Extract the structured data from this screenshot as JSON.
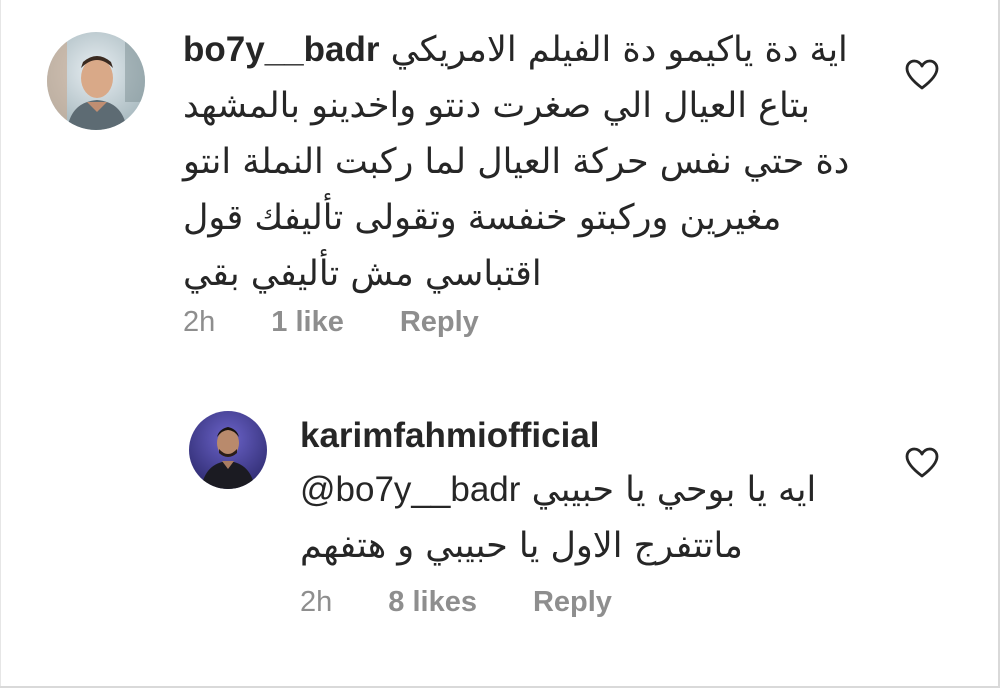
{
  "comments": [
    {
      "username": "bo7y__badr",
      "lines": [
        "اية دة ياكيمو دة الفيلم الامريكي",
        "بتاع العيال الي صغرت دنتو واخدينو بالمشهد",
        "دة حتي نفس حركة العيال لما ركبت النملة انتو",
        "مغيرين وركبتو خنفسة وتقولى تأليفك قول",
        "اقتباسي مش تأليفي بقي"
      ],
      "time": "2h",
      "likes": "1 like",
      "reply_label": "Reply",
      "avatar_icon": "profile-photo"
    },
    {
      "username": "karimfahmiofficial",
      "mention": "@bo7y__badr",
      "lines": [
        "ايه يا بوحي يا حبيبي",
        "ماتتفرج الاول يا حبيبي و هتفهم"
      ],
      "time": "2h",
      "likes": "8 likes",
      "reply_label": "Reply",
      "avatar_icon": "profile-photo"
    }
  ],
  "icons": {
    "like": "heart-outline-icon"
  },
  "colors": {
    "text": "#262626",
    "meta": "#8e8e8e",
    "background": "#ffffff"
  }
}
